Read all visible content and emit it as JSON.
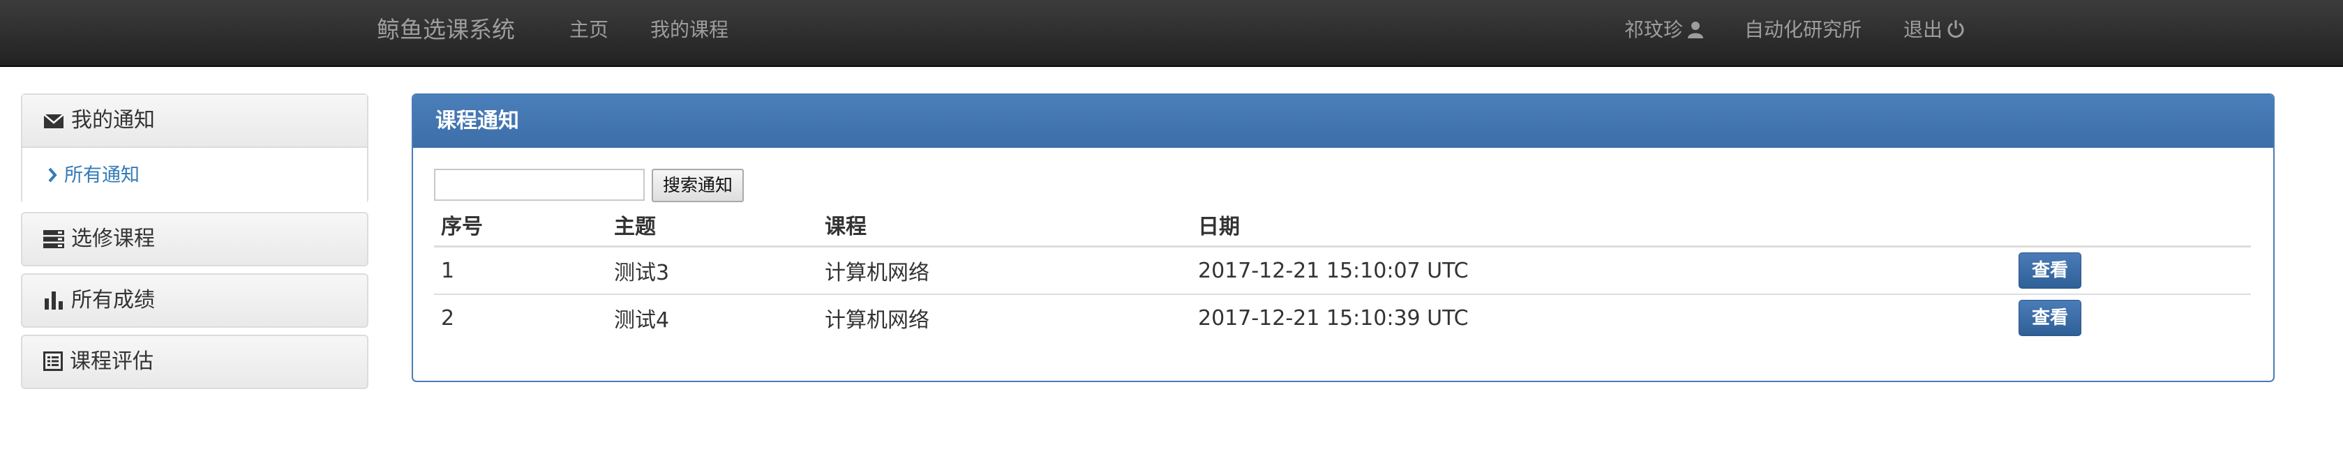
{
  "navbar": {
    "brand": "鲸鱼选课系统",
    "links": [
      {
        "label": "主页"
      },
      {
        "label": "我的课程"
      }
    ],
    "right": {
      "user": "祁玟珍",
      "department": "自动化研究所",
      "logout": "退出"
    }
  },
  "sidebar": {
    "notices": {
      "title": "我的通知",
      "sub": "所有通知"
    },
    "courses": {
      "title": "选修课程"
    },
    "grades": {
      "title": "所有成绩"
    },
    "evaluation": {
      "title": "课程评估"
    }
  },
  "panel": {
    "title": "课程通知",
    "search_button": "搜索通知",
    "search_value": "",
    "columns": [
      "序号",
      "主题",
      "课程",
      "日期"
    ],
    "rows": [
      {
        "no": "1",
        "subject": "测试3",
        "course": "计算机网络",
        "date": "2017-12-21 15:10:07 UTC",
        "action": "查看"
      },
      {
        "no": "2",
        "subject": "测试4",
        "course": "计算机网络",
        "date": "2017-12-21 15:10:39 UTC",
        "action": "查看"
      }
    ]
  },
  "colors": {
    "navbar": "#2b2b2b",
    "panel_header": "#4279b4",
    "link": "#337ab7",
    "button_primary": "#3a6aa3"
  },
  "icons": {
    "user": "user-icon",
    "logout": "power-icon",
    "notices": "envelope-icon",
    "sub": "chevron-right-icon",
    "courses": "tasks-icon",
    "grades": "bar-chart-icon",
    "evaluation": "list-alt-icon"
  }
}
